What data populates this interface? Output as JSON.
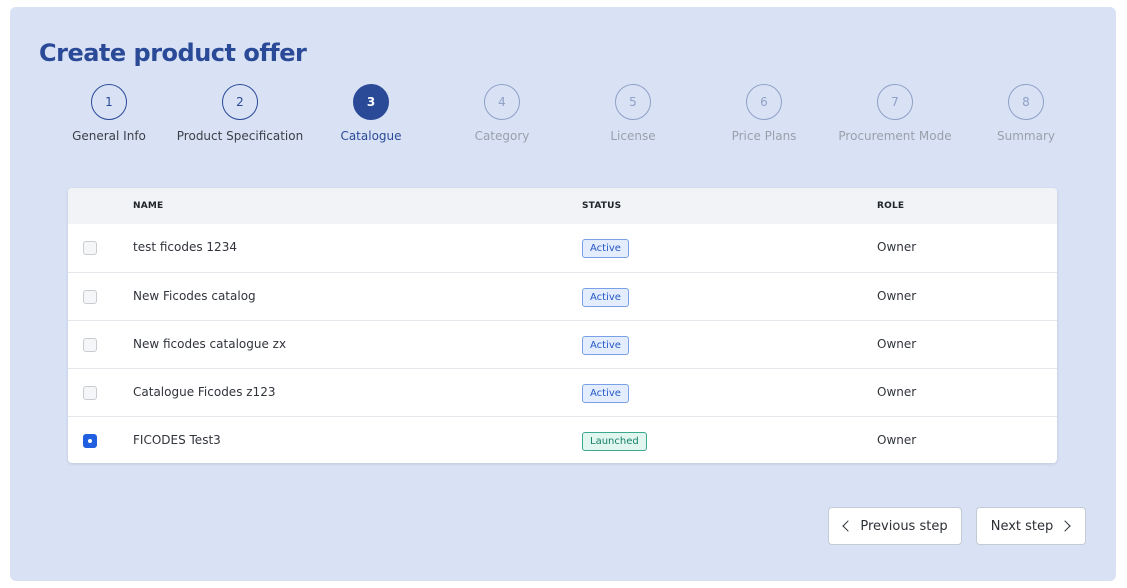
{
  "page": {
    "title": "Create product offer"
  },
  "stepper": {
    "steps": [
      {
        "number": "1",
        "label": "General Info",
        "state": "done"
      },
      {
        "number": "2",
        "label": "Product Specification",
        "state": "done"
      },
      {
        "number": "3",
        "label": "Catalogue",
        "state": "active"
      },
      {
        "number": "4",
        "label": "Category",
        "state": "future"
      },
      {
        "number": "5",
        "label": "License",
        "state": "future"
      },
      {
        "number": "6",
        "label": "Price Plans",
        "state": "future"
      },
      {
        "number": "7",
        "label": "Procurement Mode",
        "state": "future"
      },
      {
        "number": "8",
        "label": "Summary",
        "state": "future"
      }
    ]
  },
  "table": {
    "headers": {
      "name": "NAME",
      "status": "STATUS",
      "role": "ROLE"
    },
    "rows": [
      {
        "name": "test ficodes 1234",
        "status": "Active",
        "role": "Owner",
        "selected": false
      },
      {
        "name": "New Ficodes catalog",
        "status": "Active",
        "role": "Owner",
        "selected": false
      },
      {
        "name": "New ficodes catalogue zx",
        "status": "Active",
        "role": "Owner",
        "selected": false
      },
      {
        "name": "Catalogue Ficodes z123",
        "status": "Active",
        "role": "Owner",
        "selected": false
      },
      {
        "name": "FICODES Test3",
        "status": "Launched",
        "role": "Owner",
        "selected": true
      }
    ]
  },
  "footer": {
    "previous_label": "Previous step",
    "next_label": "Next step"
  },
  "colors": {
    "panel": "#d9e2f5",
    "brand": "#2a4a98",
    "checked": "#1f5fe0"
  }
}
